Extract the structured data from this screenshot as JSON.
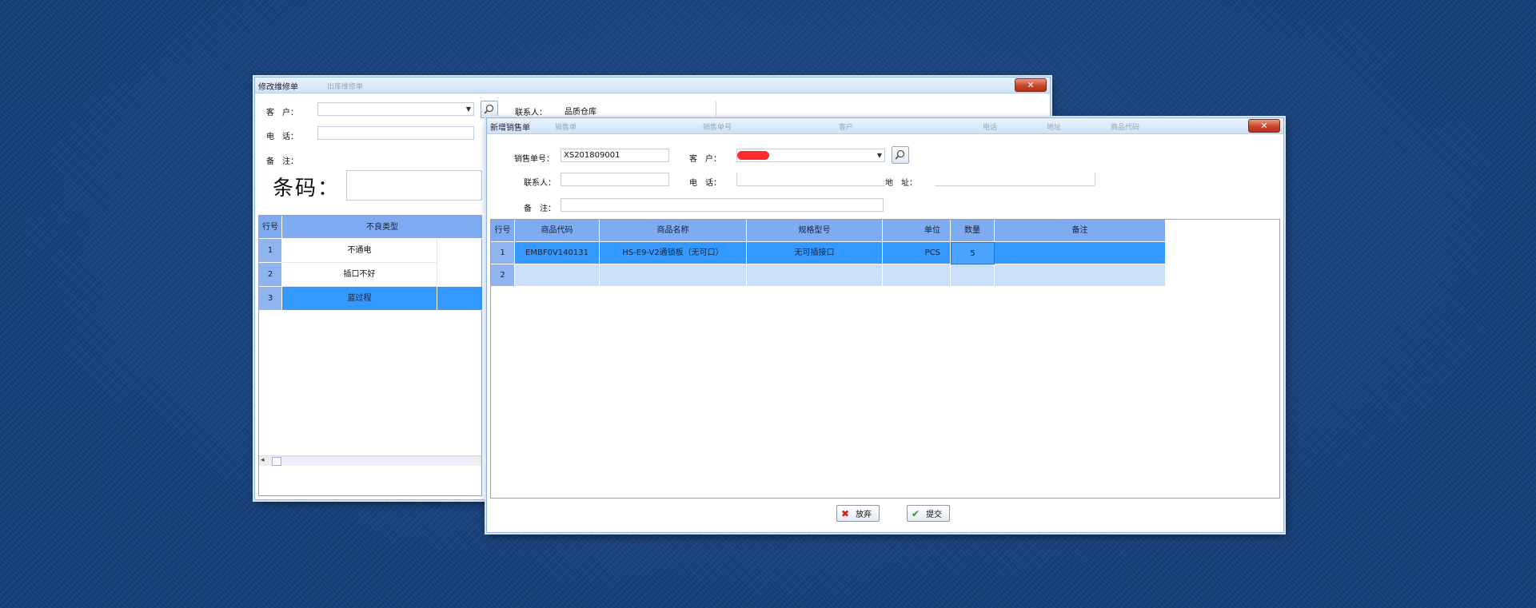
{
  "back_window": {
    "title": "修改维修单",
    "ghost_title": "出库维修单",
    "fields": {
      "customer_label": "客　户：",
      "phone_label": "电　话：",
      "address_label": "备　注：",
      "contact_label": "联系人：",
      "contact_value": "品质仓库"
    },
    "barcode_label": "条码：",
    "grid": {
      "columns": [
        "行号",
        "不良类型"
      ],
      "rows": [
        {
          "no": "1",
          "type": "不通电"
        },
        {
          "no": "2",
          "type": "插口不好"
        },
        {
          "no": "3",
          "type": "蓝过程"
        }
      ],
      "selected_row": 3
    }
  },
  "front_window": {
    "title": "新增销售单",
    "ghost_title_items": [
      "销售单",
      "销售单号",
      "客户",
      "电话",
      "地址",
      "商品代码"
    ],
    "fields": {
      "order_no_label": "销售单号：",
      "order_no_value": "XS201809001",
      "customer_label": "客　户：",
      "customer_value": "",
      "contact_label": "联系人：",
      "contact_value": "",
      "phone_label": "电　话：",
      "phone_value": "",
      "address_label": "地　址：",
      "address_value": "",
      "remark_label": "备　注：",
      "remark_value": ""
    },
    "grid": {
      "columns": [
        "行号",
        "商品代码",
        "商品名称",
        "规格型号",
        "单位",
        "数量",
        "备注"
      ],
      "rows": [
        {
          "no": "1",
          "code": "EMBF0V140131",
          "name": "HS-E9-V2通锁板（无可口）",
          "spec": "无可插接口",
          "unit": "PCS",
          "qty": "5",
          "remark": ""
        },
        {
          "no": "2",
          "code": "",
          "name": "",
          "spec": "",
          "unit": "",
          "qty": "",
          "remark": ""
        }
      ],
      "selected_row": 1
    },
    "buttons": {
      "cancel_label": "放弃",
      "submit_label": "提交"
    }
  },
  "colors": {
    "desktop": "#163f78",
    "grid_header": "#7eabf2",
    "selected_row": "#3399ff",
    "alt_row": "#cbe0f8",
    "close_button": "#c8432b",
    "redaction": "#ff2a2a"
  },
  "icons": [
    "search-icon",
    "close-icon",
    "cancel-icon",
    "check-icon",
    "dropdown-arrow-icon"
  ]
}
